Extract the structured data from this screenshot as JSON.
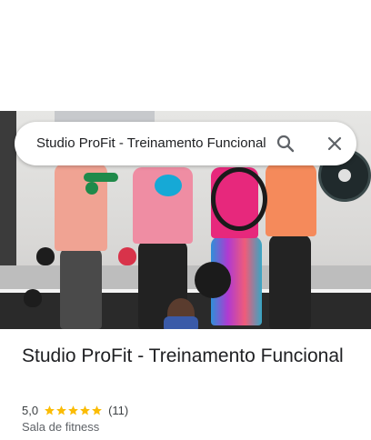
{
  "search": {
    "query": "Studio ProFit - Treinamento Funcional"
  },
  "icons": {
    "search": "search-icon",
    "close": "close-icon",
    "star": "star-icon"
  },
  "place": {
    "name": "Studio ProFit - Treinamento Funcional",
    "rating": "5,0",
    "stars": 5,
    "review_count": "(11)",
    "category": "Sala de fitness"
  },
  "colors": {
    "star": "#fbbc04",
    "text_primary": "#202124",
    "text_secondary": "#5f6368",
    "icon": "#5f6368"
  }
}
